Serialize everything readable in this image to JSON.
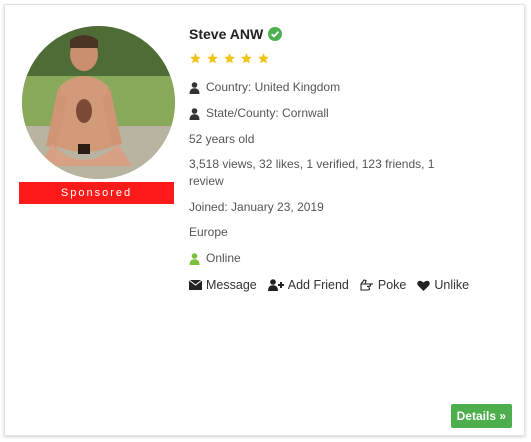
{
  "profile": {
    "name": "Steve ANW",
    "rating_stars": 5,
    "country": "Country: United Kingdom",
    "state": "State/County: Cornwall",
    "age": "52 years old",
    "stats": "3,518 views, 32 likes, 1 verified, 123 friends, 1 review",
    "joined": "Joined: January 23, 2019",
    "region": "Europe",
    "status": "Online",
    "sponsored_label": "Sponsored"
  },
  "actions": {
    "message": "Message",
    "add_friend": "Add Friend",
    "poke": "Poke",
    "unlike": "Unlike"
  },
  "details_button": "Details »",
  "colors": {
    "sponsored_bg": "#ff1a1a",
    "star": "#f0c419",
    "verified": "#4caf50",
    "online": "#7cbf3a",
    "details_bg": "#4cae4c"
  },
  "icons": [
    "verified-check-icon",
    "star-icon",
    "user-icon",
    "online-user-icon",
    "envelope-icon",
    "user-plus-icon",
    "hand-point-icon",
    "heart-icon"
  ]
}
